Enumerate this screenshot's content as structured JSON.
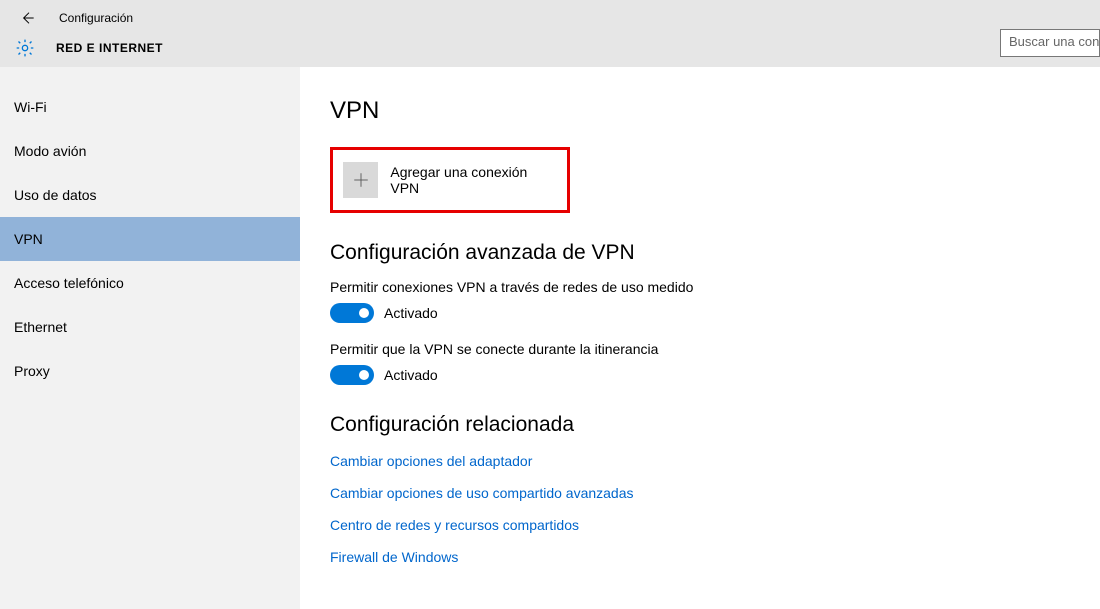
{
  "header": {
    "title": "Configuración",
    "section": "RED E INTERNET",
    "search_placeholder": "Buscar una conf"
  },
  "sidebar": {
    "items": [
      {
        "label": "Wi-Fi",
        "active": false
      },
      {
        "label": "Modo avión",
        "active": false
      },
      {
        "label": "Uso de datos",
        "active": false
      },
      {
        "label": "VPN",
        "active": true
      },
      {
        "label": "Acceso telefónico",
        "active": false
      },
      {
        "label": "Ethernet",
        "active": false
      },
      {
        "label": "Proxy",
        "active": false
      }
    ]
  },
  "main": {
    "heading": "VPN",
    "add_vpn_label": "Agregar una conexión VPN",
    "advanced_heading": "Configuración avanzada de VPN",
    "toggle1": {
      "desc": "Permitir conexiones VPN a través de redes de uso medido",
      "state": "Activado"
    },
    "toggle2": {
      "desc": "Permitir que la VPN se conecte durante la itinerancia",
      "state": "Activado"
    },
    "related_heading": "Configuración relacionada",
    "related_links": [
      "Cambiar opciones del adaptador",
      "Cambiar opciones de uso compartido avanzadas",
      "Centro de redes y recursos compartidos",
      "Firewall de Windows"
    ]
  }
}
